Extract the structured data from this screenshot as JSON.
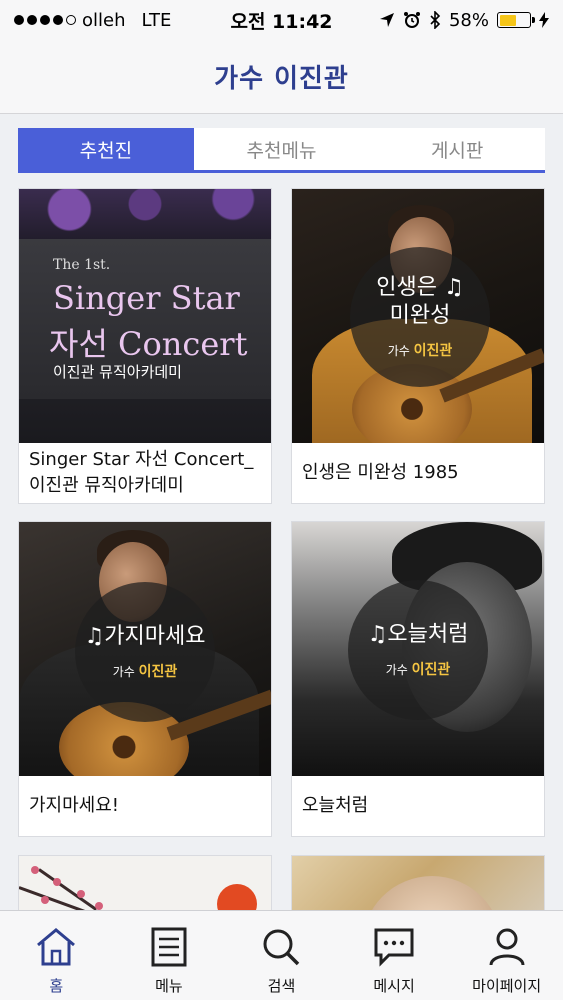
{
  "status_bar": {
    "carrier": "olleh",
    "network": "LTE",
    "time": "오전 11:42",
    "battery": "58%",
    "battery_level": 0.58,
    "signal_bars": 4
  },
  "header": {
    "title": "가수 이진관"
  },
  "tabs": [
    {
      "label": "추천진",
      "active": true
    },
    {
      "label": "추천메뉴",
      "active": false
    },
    {
      "label": "게시판",
      "active": false
    }
  ],
  "cards": [
    {
      "caption": "Singer Star 자선 Concert_이진관 뮤직아카데미",
      "art": {
        "line1": "The 1st.",
        "line2": "Singer Star",
        "line3": "자선 Concert",
        "line4": "이진관 뮤직아카데미"
      }
    },
    {
      "caption": "인생은 미완성 1985",
      "art": {
        "title_line1": "인생은 ♫",
        "title_line2": "미완성",
        "sub_prefix": "가수",
        "sub_name": "이진관"
      }
    },
    {
      "caption": "가지마세요!",
      "art": {
        "title_line1": "♫가지마세요",
        "sub_prefix": "가수",
        "sub_name": "이진관"
      }
    },
    {
      "caption": "오늘처럼",
      "art": {
        "title_line1": "♫오늘처럼",
        "sub_prefix": "가수",
        "sub_name": "이진관"
      }
    },
    {
      "caption": ""
    },
    {
      "caption": ""
    }
  ],
  "bottom_nav": [
    {
      "label": "홈",
      "icon": "home-icon",
      "active": true
    },
    {
      "label": "메뉴",
      "icon": "menu-list-icon",
      "active": false
    },
    {
      "label": "검색",
      "icon": "search-icon",
      "active": false
    },
    {
      "label": "메시지",
      "icon": "message-icon",
      "active": false
    },
    {
      "label": "마이페이지",
      "icon": "person-icon",
      "active": false
    }
  ],
  "colors": {
    "accent": "#4a5fd8",
    "title": "#2e3f8f",
    "battery": "#f5c518",
    "highlight_name": "#f5c542"
  }
}
